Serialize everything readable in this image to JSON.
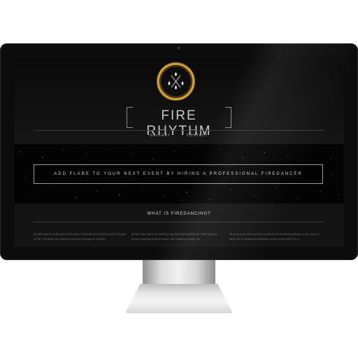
{
  "site": {
    "brand": "FIRE RHYTHM",
    "nav": [
      {
        "label": "GALLERY"
      },
      {
        "label": "CONTACT"
      }
    ],
    "hero_cta": "ADD FLARE TO YOUR NEXT EVENT BY HIRING A PROFESSIONAL FIREDANCER",
    "section_title": "WHAT IS FIREDANCING?",
    "columns": [
      {
        "text": "Ancient Aztecs performed a fire dance dedicated to Huehuecoyotl, the god of fire. The Aztec fire dance is performed today for tourists"
      },
      {
        "text": "perform the dance by holding rods representing flames, while leaping around burning coconut husks, and walking through the"
      },
      {
        "text": "dancing men often perform a dance that involves walking on hot coals. A large fire is created and allowed to burn down until it is a"
      }
    ]
  },
  "colors": {
    "accent": "#d9a030",
    "bezel": "#0c0c0c",
    "screen_bg": "#060606"
  }
}
